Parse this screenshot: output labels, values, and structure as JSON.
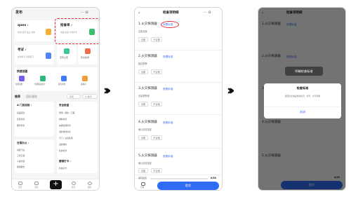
{
  "p1": {
    "title": "发布",
    "top_icons": "··· ⊙",
    "card_task": {
      "title": "ques ›",
      "sub": "每周 任务 截止 完成"
    },
    "card_check": {
      "title": "检查单 ›",
      "sub": "先做 后看 查找检查"
    },
    "card_exam": {
      "title": "考试 ›",
      "sub": "在线学习 答题练习"
    },
    "card_teach": "宣传之家",
    "card_safe": "安全检测",
    "quick_title": "快速创建",
    "quick_items": [
      "智能巡检",
      "智能报表统计",
      "报告排查",
      "模拟库"
    ],
    "tabs": [
      "推荐",
      "团队服务"
    ],
    "search_label": "搜索",
    "ai_label": "AI 助手",
    "sec_a": {
      "title": "A 门店巡检 ›",
      "items": [
        "商品陈列",
        "店员培训",
        "服务检查"
      ]
    },
    "sec_b": {
      "title": "安全检查",
      "items": [
        "现场 / 消防 / 工程",
        "燃料检查",
        "车辆资源检查",
        "消防排查检查",
        "灭门 / 过道检测",
        "设施维护",
        "防护检查"
      ]
    },
    "sec_c": {
      "title": "日常办公 ›",
      "items": [
        "请假下班",
        "工作汇报",
        "人事行政",
        "报销报告"
      ]
    },
    "sec_d": {
      "title": "营销打卡 ›",
      "items": [
        "外勤打卡"
      ]
    },
    "nav": [
      "首页",
      "消息",
      "",
      "任务",
      "我的"
    ]
  },
  "p2": {
    "title": "检查项明细",
    "top_icons": "··· ⊙",
    "items": [
      {
        "name": "1.火灾探测器",
        "link": "查看标准",
        "desc": "否阻挡案",
        "opts": [
          "合格",
          "不合格"
        ]
      },
      {
        "name": "2.火灾探测器",
        "link": "查看标准",
        "desc": "阻挡报警",
        "opts": [
          "合格",
          "不合格"
        ]
      },
      {
        "name": "3.火灾探测器",
        "link": "查看标准",
        "desc": "安装报警案",
        "opts": [
          "合格",
          "不合格"
        ]
      },
      {
        "name": "4.火灾探测器",
        "link": "查看标准",
        "desc": "确认检查描述",
        "opts": [
          "合格",
          "不合格"
        ]
      },
      {
        "name": "5.火灾探测器",
        "link": "查看标准",
        "desc": "确认检查描述",
        "opts": [
          "合格",
          "不合格"
        ]
      }
    ],
    "progress_label": "填写检查",
    "progress_value": "0/50",
    "bottom_icon_label": "全部",
    "submit": "提交"
  },
  "p3": {
    "toast": "明确检查标准",
    "dialog_title": "检查标准",
    "dialog_body": "发现隐患或是整改情况，检查、文字清晰",
    "dialog_close": "关闭",
    "progress_value": "0/50",
    "submit": "提交"
  }
}
